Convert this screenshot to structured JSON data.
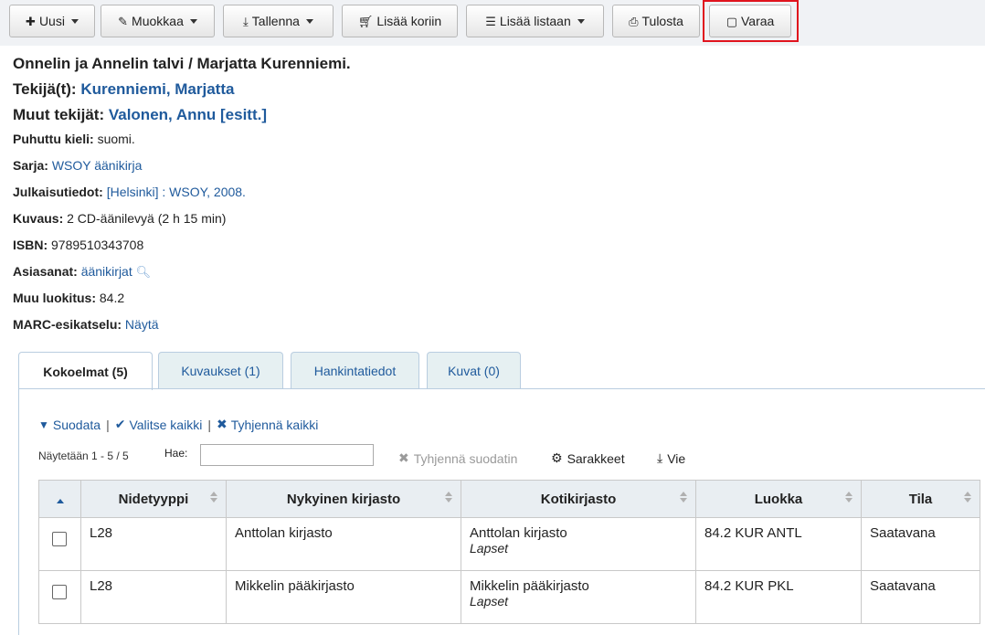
{
  "toolbar": {
    "new": "Uusi",
    "edit": "Muokkaa",
    "save": "Tallenna",
    "add_cart": "Lisää koriin",
    "add_list": "Lisää listaan",
    "print": "Tulosta",
    "hold": "Varaa"
  },
  "record": {
    "title": "Onnelin ja Annelin talvi / Marjatta Kurenniemi.",
    "author_label": "Tekijä(t):",
    "author": "Kurenniemi, Marjatta",
    "contrib_label": "Muut tekijät:",
    "contrib": "Valonen, Annu [esitt.]",
    "language_label": "Puhuttu kieli:",
    "language": "suomi.",
    "series_label": "Sarja:",
    "series": "WSOY äänikirja",
    "pub_label": "Julkaisutiedot:",
    "pub": "[Helsinki] : WSOY, 2008.",
    "desc_label": "Kuvaus:",
    "desc": "2 CD-äänilevyä (2 h 15 min)",
    "isbn_label": "ISBN:",
    "isbn": "9789510343708",
    "subject_label": "Asiasanat:",
    "subject": "äänikirjat",
    "class_label": "Muu luokitus:",
    "class": "84.2",
    "marc_label": "MARC-esikatselu:",
    "marc": "Näytä"
  },
  "tabs": [
    "Kokoelmat (5)",
    "Kuvaukset (1)",
    "Hankintatiedot",
    "Kuvat (0)"
  ],
  "holdings": {
    "filter": "Suodata",
    "select_all": "Valitse kaikki",
    "clear_all": "Tyhjennä kaikki",
    "showing": "Näytetään 1 - 5 / 5",
    "search_label": "Hae:",
    "clear_filter": "Tyhjennä suodatin",
    "columns": "Sarakkeet",
    "export": "Vie",
    "headers": [
      "Nidetyyppi",
      "Nykyinen kirjasto",
      "Kotikirjasto",
      "Luokka",
      "Tila"
    ],
    "rows": [
      {
        "type": "L28",
        "current": "Anttolan kirjasto",
        "home": "Anttolan kirjasto",
        "home_sub": "Lapset",
        "callno": "84.2 KUR ANTL",
        "status": "Saatavana"
      },
      {
        "type": "L28",
        "current": "Mikkelin pääkirjasto",
        "home": "Mikkelin pääkirjasto",
        "home_sub": "Lapset",
        "callno": "84.2 KUR PKL",
        "status": "Saatavana"
      }
    ]
  },
  "colors": {
    "link": "#1f5a9c",
    "highlight": "#e0141e"
  }
}
